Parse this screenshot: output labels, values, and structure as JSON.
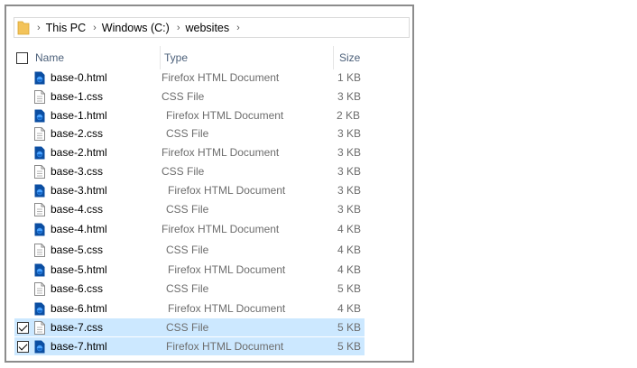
{
  "breadcrumb": [
    "This PC",
    "Windows (C:)",
    "websites"
  ],
  "columns": {
    "name": "Name",
    "type": "Type",
    "size": "Size"
  },
  "files": [
    {
      "name": "base-0.html",
      "type": "Firefox HTML Document",
      "size": "1 KB",
      "icon": "firefox-html-icon",
      "selected": false
    },
    {
      "name": "base-1.css",
      "type": "CSS File",
      "size": "3 KB",
      "icon": "css-file-icon",
      "selected": false
    },
    {
      "name": "base-1.html",
      "type": "Firefox HTML Document",
      "size": "2 KB",
      "icon": "firefox-html-icon",
      "selected": false
    },
    {
      "name": "base-2.css",
      "type": "CSS File",
      "size": "3 KB",
      "icon": "css-file-icon",
      "selected": false
    },
    {
      "name": "base-2.html",
      "type": "Firefox HTML Document",
      "size": "3 KB",
      "icon": "firefox-html-icon",
      "selected": false
    },
    {
      "name": "base-3.css",
      "type": "CSS File",
      "size": "3 KB",
      "icon": "css-file-icon",
      "selected": false
    },
    {
      "name": "base-3.html",
      "type": "Firefox HTML Document",
      "size": "3 KB",
      "icon": "firefox-html-icon",
      "selected": false
    },
    {
      "name": "base-4.css",
      "type": "CSS File",
      "size": "3 KB",
      "icon": "css-file-icon",
      "selected": false
    },
    {
      "name": "base-4.html",
      "type": "Firefox HTML Document",
      "size": "4 KB",
      "icon": "firefox-html-icon",
      "selected": false
    },
    {
      "name": "base-5.css",
      "type": "CSS File",
      "size": "4 KB",
      "icon": "css-file-icon",
      "selected": false
    },
    {
      "name": "base-5.html",
      "type": "Firefox HTML Document",
      "size": "4 KB",
      "icon": "firefox-html-icon",
      "selected": false
    },
    {
      "name": "base-6.css",
      "type": "CSS File",
      "size": "5 KB",
      "icon": "css-file-icon",
      "selected": false
    },
    {
      "name": "base-6.html",
      "type": "Firefox HTML Document",
      "size": "4 KB",
      "icon": "firefox-html-icon",
      "selected": false
    },
    {
      "name": "base-7.css",
      "type": "CSS File",
      "size": "5 KB",
      "icon": "css-file-icon",
      "selected": true
    },
    {
      "name": "base-7.html",
      "type": "Firefox HTML Document",
      "size": "5 KB",
      "icon": "firefox-html-icon",
      "selected": true
    }
  ],
  "colors": {
    "selection": "#cce8ff",
    "header_text": "#4c607a",
    "firefox_icon": "#0b4ea2"
  }
}
